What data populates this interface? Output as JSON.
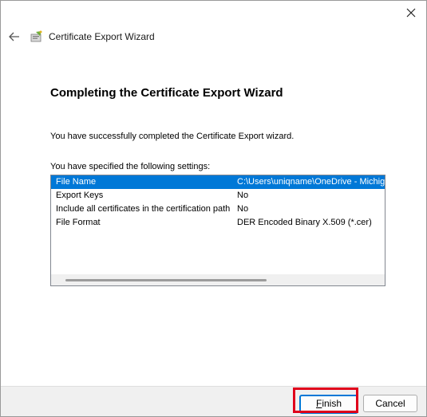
{
  "window": {
    "title": "Certificate Export Wizard"
  },
  "wizard": {
    "heading": "Completing the Certificate Export Wizard",
    "success_message": "You have successfully completed the Certificate Export wizard.",
    "settings_intro": "You have specified the following settings:",
    "settings": [
      {
        "key": "File Name",
        "value": "C:\\Users\\uniqname\\OneDrive - Michiga",
        "selected": true
      },
      {
        "key": "Export Keys",
        "value": "No",
        "selected": false
      },
      {
        "key": "Include all certificates in the certification path",
        "value": "No",
        "selected": false
      },
      {
        "key": "File Format",
        "value": "DER Encoded Binary X.509 (*.cer)",
        "selected": false
      }
    ]
  },
  "buttons": {
    "finish_label": "Finish",
    "finish_mnemonic": "F",
    "finish_rest": "inish",
    "cancel_label": "Cancel"
  },
  "colors": {
    "selection": "#0078d7",
    "highlight": "#e0001b"
  }
}
